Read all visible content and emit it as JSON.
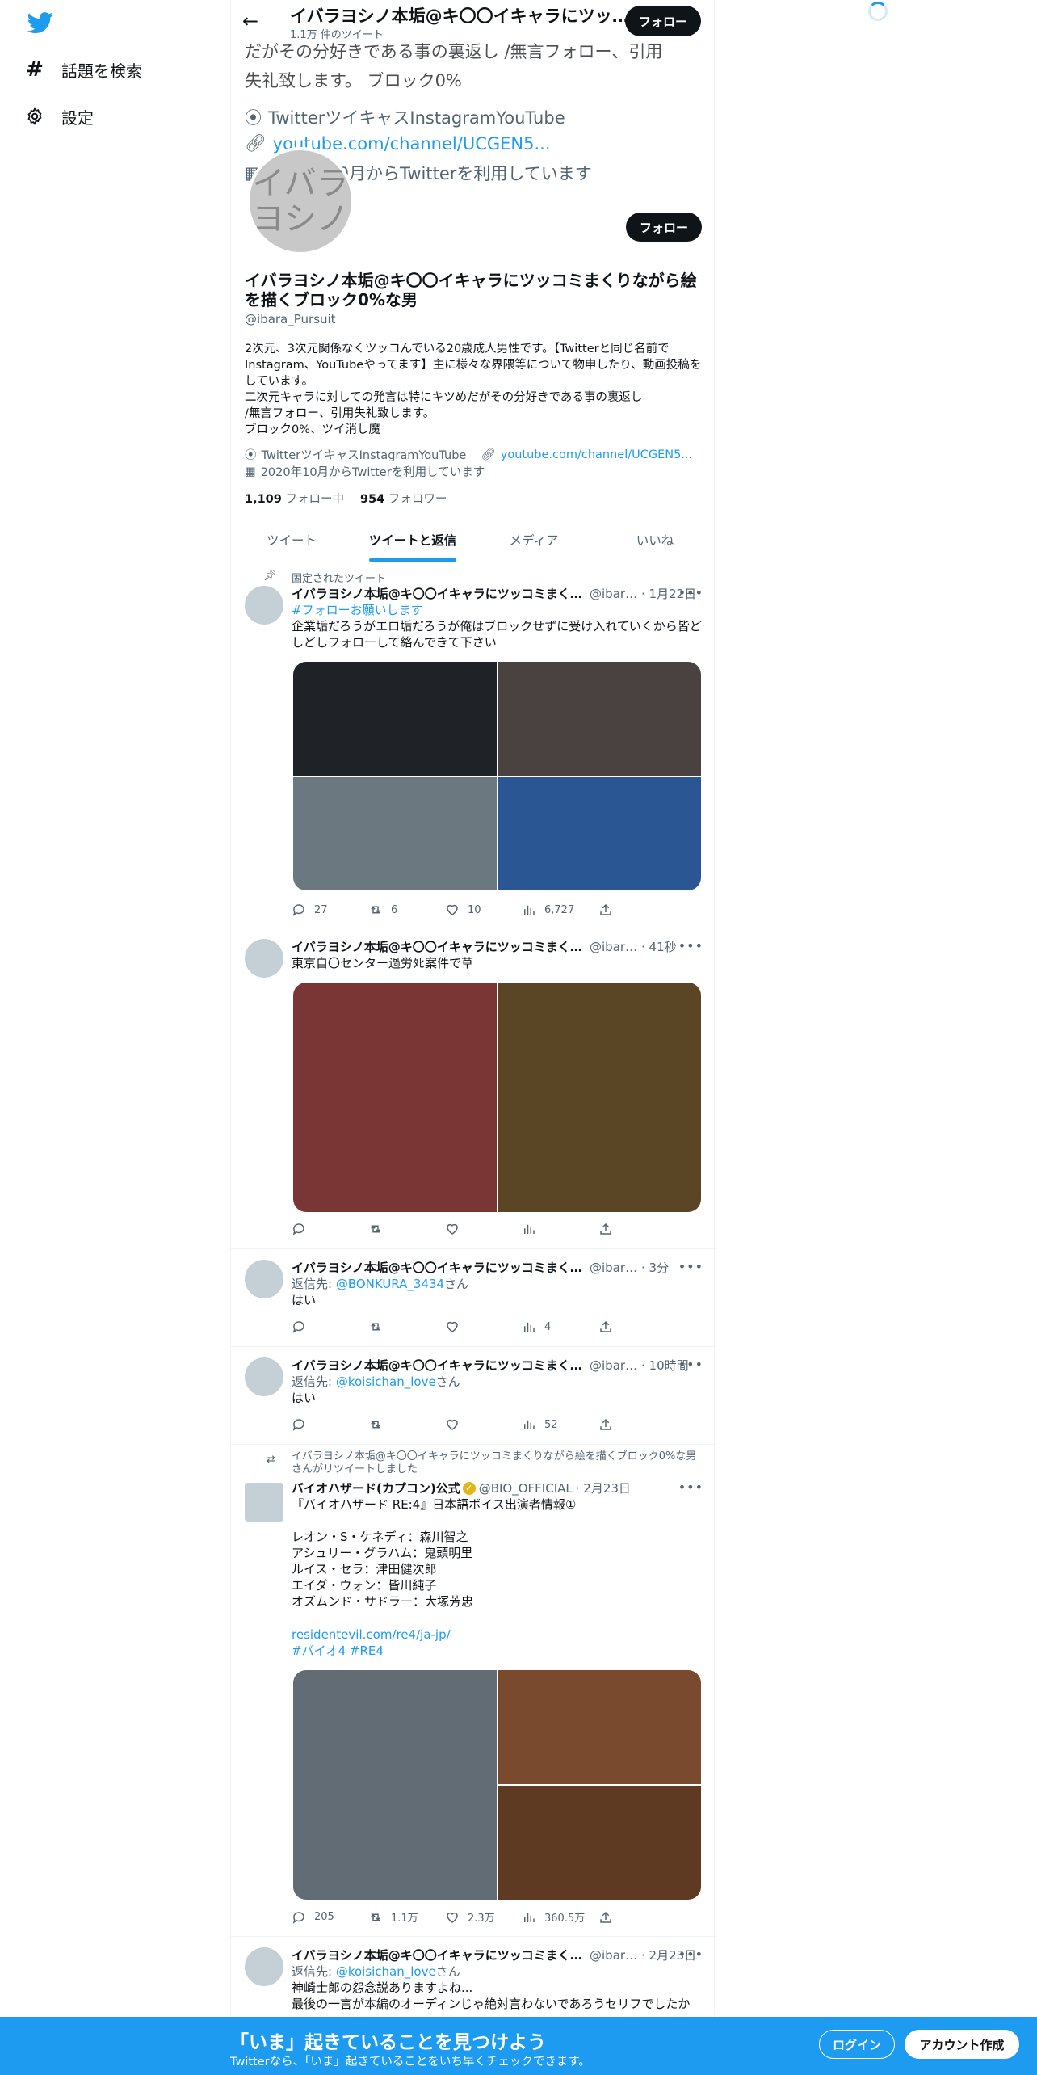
{
  "nav": {
    "explore": "話題を検索",
    "settings": "設定"
  },
  "header": {
    "title": "イバラヨシノ本垢@キ〇〇イキャラにツッコミまくりながら絵を描くブロック0%な男",
    "subtitle": "1.1万 件のツイート",
    "follow": "フォロー"
  },
  "ghost": {
    "line1": "だがその分好きである事の裏返し /無言フォロー、引用",
    "line2": "失礼致します。 ブロック0%",
    "line3": "TwitterツイキャスInstagramYouTube",
    "line4": "youtube.com/channel/UCGEN5...",
    "line5": "2020年10月からTwitterを利用しています",
    "avatar_text": "イバラ\nヨシノ"
  },
  "profile": {
    "follow": "フォロー",
    "name": "イバラヨシノ本垢@キ〇〇イキャラにツッコミまくりながら絵を描くブロック0%な男",
    "handle": "@ibara_Pursuit",
    "bio": "2次元、3次元関係なくツッコんでいる20歳成人男性です。【Twitterと同じ名前でInstagram、YouTubeやってます】主に様々な界隈等について物申したり、動画投稿をしています。\n二次元キャラに対しての発言は特にキツめだがその分好きである事の裏返し\n/無言フォロー、引用失礼致します。\nブロック0%、ツイ消し魔",
    "location": "TwitterツイキャスInstagramYouTube",
    "url": "youtube.com/channel/UCGEN5...",
    "joined": "2020年10月からTwitterを利用しています",
    "following_count": "1,109",
    "following_label": "フォロー中",
    "followers_count": "954",
    "followers_label": "フォロワー"
  },
  "tabs": [
    "ツイート",
    "ツイートと返信",
    "メディア",
    "いいね"
  ],
  "tweets": [
    {
      "context": "固定されたツイート",
      "name": "イバラヨシノ本垢@キ〇〇イキャラにツッコミまくりながら絵を描くブロック0%な男",
      "handle": "@ibara_Pursuit",
      "time": "· 1月22日",
      "hashtag": "#フォローお願いします",
      "text": "企業垢だろうがエロ垢だろうが俺はブロックせずに受け入れていくから皆どしどしフォローして絡んできて下さい",
      "reply": "27",
      "retweet": "6",
      "like": "10",
      "views": "6,727",
      "media_colors": [
        "#1f2226",
        "#4a4240",
        "#6b7880",
        "#2a5693"
      ]
    },
    {
      "name": "イバラヨシノ本垢@キ〇〇イキャラにツッコミまくりながら絵を描くブロック0%な男",
      "handle": "@ibara_Pursuit",
      "time": "· 41秒",
      "text": "東京自〇センター過労ﾀﾋ案件で草",
      "reply": "",
      "retweet": "",
      "like": "",
      "views": "",
      "media_colors": [
        "#7a3535",
        "#5a4525"
      ]
    },
    {
      "name": "イバラヨシノ本垢@キ〇〇イキャラにツッコミまくりながら絵を描くブロック0%な男",
      "handle": "@ibara_Pursuit",
      "time": "· 3分",
      "reply_to_label": "返信先: ",
      "reply_to": "@BONKURA_3434",
      "reply_suffix": "さん",
      "text": "はい",
      "reply": "",
      "retweet": "",
      "like": "",
      "views": "4"
    },
    {
      "name": "イバラヨシノ本垢@キ〇〇イキャラにツッコミまくりながら絵を描くブロック0%な男",
      "handle": "@ibara_Pursuit",
      "time": "· 10時間",
      "reply_to_label": "返信先: ",
      "reply_to": "@koisichan_love",
      "reply_suffix": "さん",
      "text": "はい",
      "reply": "",
      "retweet": "",
      "like": "",
      "views": "52"
    },
    {
      "context": "イバラヨシノ本垢@キ〇〇イキャラにツッコミまくりながら絵を描くブロック0%な男さんがリツイートしました",
      "name": "バイオハザード(カプコン)公式",
      "handle": "@BIO_OFFICIAL",
      "time": "· 2月23日",
      "text": "『バイオハザード RE:4』日本語ボイス出演者情報①\n\nレオン・S・ケネディ：森川智之\nアシュリー・グラハム：鬼頭明里\nルイス・セラ：津田健次郎\nエイダ・ウォン：皆川純子\nオズムンド・サドラー：大塚芳忠",
      "link": "residentevil.com/re4/ja-jp/",
      "tags": "#バイオ4 #RE4",
      "reply": "205",
      "retweet": "1.1万",
      "like": "2.3万",
      "views": "360.5万",
      "media_colors": [
        "#626c75",
        "#7a4a2e",
        "#5e3a22"
      ]
    },
    {
      "name": "イバラヨシノ本垢@キ〇〇イキャラにツッコミまくりながら絵を描くブロック0%な男",
      "handle": "@ibara_Pursuit",
      "time": "· 2月23日",
      "reply_to_label": "返信先: ",
      "reply_to": "@koisichan_love",
      "reply_suffix": "さん",
      "text": "神崎士郎の怨念説ありますよね...\n最後の一言が本編のオーディンじゃ絶対言わないであろうセリフでしたか"
    }
  ],
  "banner": {
    "title": "「いま」起きていることを見つけよう",
    "subtitle": "Twitterなら、「いま」起きていることをいち早くチェックできます。",
    "login": "ログイン",
    "signup": "アカウント作成"
  },
  "colors": {
    "accent": "#1d9bf0",
    "text": "#0f1419",
    "secondary": "#536471"
  }
}
